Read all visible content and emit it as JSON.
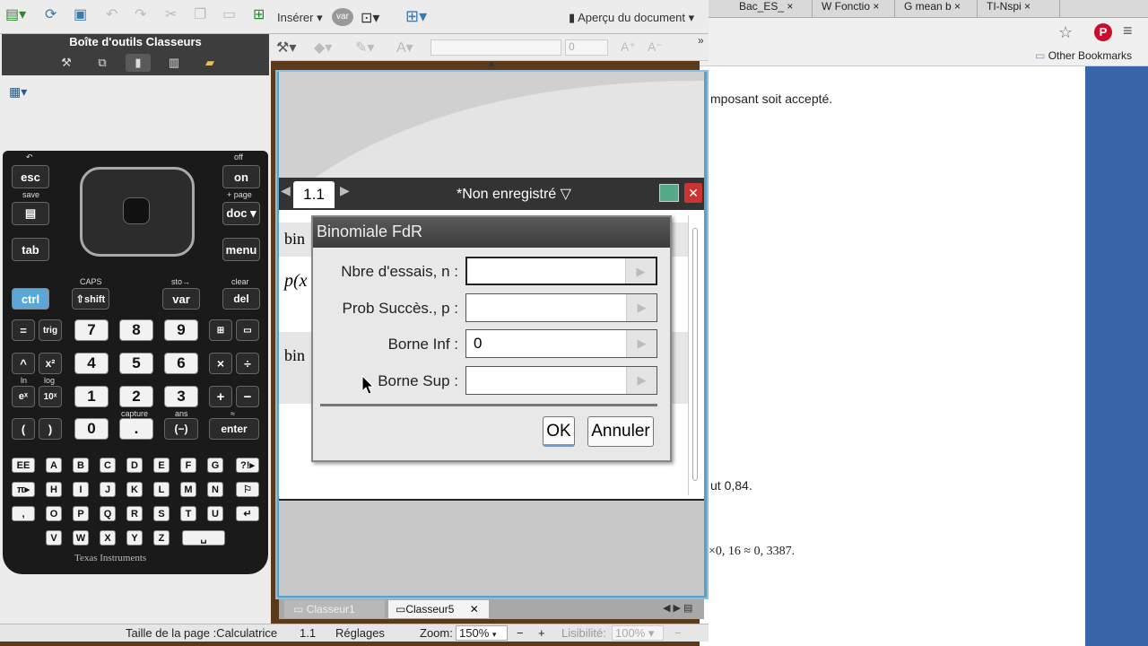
{
  "browser": {
    "tabs": [
      "Bac_ES_",
      "W Fonctio",
      "G mean b",
      "TI-Nspi"
    ],
    "bookmark_folder": "Other Bookmarks",
    "text_lines": [
      "mposant soit accepté.",
      "ut 0,84.",
      "×0, 16 ≈ 0, 3387."
    ]
  },
  "toolbar": {
    "insert_label": "Insérer",
    "var_label": "var",
    "preview_label": "Aperçu du document",
    "size_value": "0"
  },
  "left_panel": {
    "title": "Boîte d'outils Classeurs"
  },
  "calculator": {
    "brand": "Texas Instruments",
    "top_labels": {
      "undo": "↶",
      "off": "off",
      "save": "save",
      "page": "+ page",
      "caps": "CAPS",
      "sto": "sto→",
      "clear": "clear",
      "capture": "capture",
      "ans": "ans",
      "approx": "≈",
      "ln": "ln",
      "log": "log"
    },
    "keys": {
      "esc": "esc",
      "on": "on",
      "doc": "doc ▾",
      "menu": "menu",
      "tab": "tab",
      "ctrl": "ctrl",
      "shift": "⇧shift",
      "var": "var",
      "del": "del",
      "eq": "=",
      "trig": "trig",
      "caret": "^",
      "x2": "x²",
      "ex": "eˣ",
      "tenx": "10ˣ",
      "lpar": "(",
      "rpar": ")",
      "n7": "7",
      "n8": "8",
      "n9": "9",
      "n4": "4",
      "n5": "5",
      "n6": "6",
      "n1": "1",
      "n2": "2",
      "n3": "3",
      "n0": "0",
      "dot": ".",
      "neg": "(−)",
      "mul": "×",
      "div": "÷",
      "plus": "+",
      "minus": "−",
      "enter": "enter"
    },
    "alpha_rows": [
      [
        "EE",
        "A",
        "B",
        "C",
        "D",
        "E",
        "F",
        "G",
        "?!▸"
      ],
      [
        "π▸",
        "H",
        "I",
        "J",
        "K",
        "L",
        "M",
        "N",
        "⚐"
      ],
      [
        ",",
        "O",
        "P",
        "Q",
        "R",
        "S",
        "T",
        "U",
        "↵"
      ],
      [
        "V",
        "W",
        "X",
        "Y",
        "Z",
        "␣"
      ]
    ]
  },
  "document": {
    "page_tab": "1.1",
    "title": "*Non enregistré",
    "partial_text": [
      "bin",
      "p(x",
      "bin"
    ],
    "tabs": [
      "Classeur1",
      "Classeur5"
    ]
  },
  "dialog": {
    "title": "Binomiale FdR",
    "fields": [
      {
        "label": "Nbre d'essais, n :",
        "value": ""
      },
      {
        "label": "Prob Succès., p :",
        "value": ""
      },
      {
        "label": "Borne Inf :",
        "value": "0"
      },
      {
        "label": "Borne Sup :",
        "value": ""
      }
    ],
    "ok_label": "OK",
    "cancel_label": "Annuler"
  },
  "status_bar": {
    "page_size": "Taille de la page :Calculatrice",
    "page_num": "1.1",
    "settings": "Réglages",
    "zoom_label": "Zoom:",
    "zoom_value": "150%",
    "readability_label": "Lisibilité:",
    "readability_value": "100%"
  }
}
